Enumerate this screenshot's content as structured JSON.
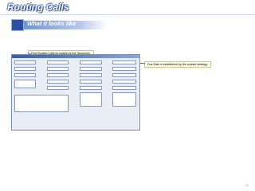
{
  "slide": {
    "title": "Routing Calls",
    "subtitle": "What it looks like",
    "page_number": "31"
  },
  "callouts": {
    "left": "Find Routing Calls by looking at the Taxonomy.",
    "right": "Due Date is established by the contact strategy."
  },
  "app": {
    "window_title": "",
    "columns": [
      [
        {
          "label": "",
          "value": ""
        },
        {
          "label": "",
          "value": ""
        },
        {
          "label": "",
          "value": ""
        },
        {
          "label": "",
          "value": "",
          "box": "multi"
        }
      ],
      [
        {
          "label": "",
          "value": ""
        },
        {
          "label": "",
          "value": ""
        },
        {
          "label": "",
          "value": ""
        },
        {
          "label": "",
          "value": ""
        },
        {
          "label": "",
          "value": ""
        }
      ],
      [
        {
          "label": "",
          "value": ""
        },
        {
          "label": "",
          "value": ""
        },
        {
          "label": "",
          "value": ""
        },
        {
          "label": "",
          "value": ""
        },
        {
          "label": "",
          "value": ""
        },
        {
          "label": "",
          "value": "",
          "box": "tall"
        }
      ],
      [
        {
          "label": "",
          "value": ""
        },
        {
          "label": "",
          "value": ""
        },
        {
          "label": "",
          "value": ""
        },
        {
          "label": "",
          "value": ""
        },
        {
          "label": "",
          "value": ""
        },
        {
          "label": "",
          "value": "",
          "box": "tall"
        }
      ]
    ],
    "notes": {
      "label": "",
      "value": ""
    }
  }
}
